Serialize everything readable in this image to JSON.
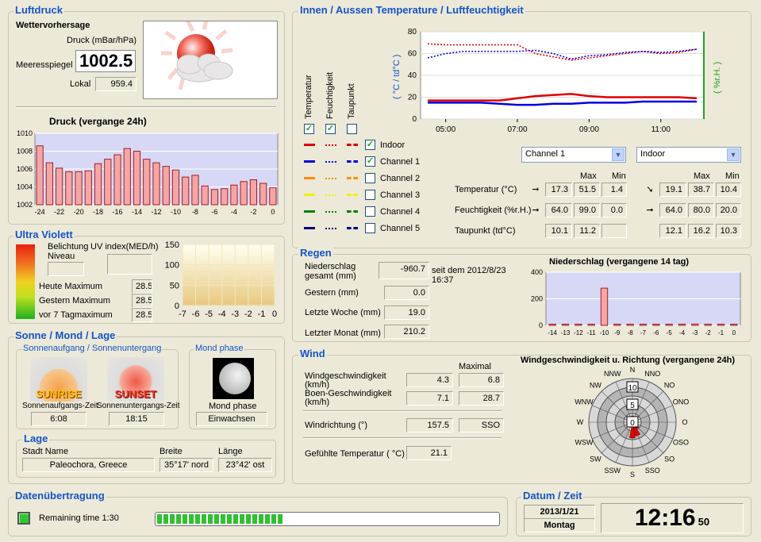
{
  "luftdruck": {
    "title": "Luftdruck",
    "forecast_label": "Wettervorhersage",
    "druck_label": "Druck (mBar/hPa)",
    "sea_label": "Meeresspiegel",
    "sea_value": "1002.5",
    "local_label": "Lokal",
    "local_value": "959.4",
    "chart_title": "Druck (vergange 24h)"
  },
  "temp_section": {
    "title": "Innen / Aussen Temperature / Luftfeuchtigkeit",
    "col_temp": "Temperatur",
    "col_hum": "Feuchtigkeit",
    "col_dew": "Taupunkt",
    "left_axis": "( °C / td°C )",
    "right_axis": "( %r.H. )",
    "channels": [
      {
        "name": "Indoor",
        "checked": true,
        "color": "#e00000"
      },
      {
        "name": "Channel 1",
        "checked": true,
        "color": "#0000e0"
      },
      {
        "name": "Channel 2",
        "checked": false,
        "color": "#ff8c00"
      },
      {
        "name": "Channel 3",
        "checked": false,
        "color": "#f0f000"
      },
      {
        "name": "Channel 4",
        "checked": false,
        "color": "#008000"
      },
      {
        "name": "Channel 5",
        "checked": false,
        "color": "#000080"
      }
    ],
    "select_left": "Channel 1",
    "select_right": "Indoor",
    "max_label": "Max",
    "min_label": "Min",
    "rows": [
      {
        "label": "Temperatur (°C)",
        "l_val": "17.3",
        "l_max": "51.5",
        "l_min": "1.4",
        "r_val": "19.1",
        "r_max": "38.7",
        "r_min": "10.4"
      },
      {
        "label": "Feuchtigkeit (%r.H.)",
        "l_val": "64.0",
        "l_max": "99.0",
        "l_min": "0.0",
        "r_val": "64.0",
        "r_max": "80.0",
        "r_min": "20.0"
      },
      {
        "label": "Taupunkt (td°C)",
        "l_val": "10.1",
        "l_max": "11.2",
        "l_min": "",
        "r_val": "12.1",
        "r_max": "16.2",
        "r_min": "10.3"
      }
    ]
  },
  "uv": {
    "title": "Ultra Violett",
    "belichtung": "Belichtung",
    "niveau": "Niveau",
    "uv_index": "UV index(MED/h)",
    "today_label": "Heute Maximum",
    "today": "28.5",
    "yesterday_label": "Gestern Maximum",
    "yesterday": "28.5",
    "week_label": "vor 7 Tagmaximum",
    "week": "28.5"
  },
  "sun": {
    "title": "Sonne / Mond / Lage",
    "sub": "Sonnenaufgang / Sonnenuntergang",
    "sunrise_img": "SUNRISE",
    "sunset_img": "SUNSET",
    "sunrise_label": "Sonnenaufgangs-Zeit",
    "sunset_label": "Sonnenuntergangs-Zeit",
    "sunrise": "6:08",
    "sunset": "18:15",
    "moon_title": "Mond phase",
    "moon_label": "Mond phase",
    "moon_value": "Einwachsen"
  },
  "lage": {
    "title": "Lage",
    "city_label": "Stadt Name",
    "city": "Paleochora, Greece",
    "lat_label": "Breite",
    "lat": "35°17' nord",
    "lon_label": "Länge",
    "lon": "23°42' ost"
  },
  "regen": {
    "title": "Regen",
    "total_label": "Niederschlag gesamt (mm)",
    "total": "-960.7",
    "since": "seit dem 2012/8/23 16:37",
    "yesterday_label": "Gestern (mm)",
    "yesterday": "0.0",
    "week_label": "Letzte Woche (mm)",
    "week": "19.0",
    "month_label": "Letzter Monat (mm)",
    "month": "210.2",
    "chart_title": "Niederschlag (vergangene 14 tag)"
  },
  "wind": {
    "title": "Wind",
    "max_label": "Maximal",
    "speed_label": "Windgeschwindigkeit (km/h)",
    "speed": "4.3",
    "speed_max": "6.8",
    "gust_label": "Boen-Geschwindigkeit (km/h)",
    "gust": "7.1",
    "gust_max": "28.7",
    "dir_label": "Windrichtung (°)",
    "dir": "157.5",
    "dir_name": "SSO",
    "feel_label": "Gefühlte Temperatur ( °C)",
    "feel": "21.1",
    "rose_title": "Windgeschwindigkeit u. Richtung (vergangene 24h)",
    "compass": [
      "N",
      "NNO",
      "NO",
      "ONO",
      "O",
      "OSO",
      "SO",
      "SSO",
      "S",
      "SSW",
      "SW",
      "WSW",
      "W",
      "WNW",
      "NW",
      "NNW"
    ],
    "ring_labels": [
      "10",
      "5",
      "0"
    ]
  },
  "transfer": {
    "title": "Datenübertragung",
    "remaining": "Remaining time 1:30",
    "progress": 0.37
  },
  "datetime": {
    "title": "Datum / Zeit",
    "date": "2013/1/21",
    "day": "Montag",
    "time": "12:16",
    "seconds": "50"
  },
  "chart_data": [
    {
      "type": "bar",
      "title": "Druck (vergange 24h)",
      "categories": [
        "-24",
        "-23",
        "-22",
        "-21",
        "-20",
        "-19",
        "-18",
        "-17",
        "-16",
        "-15",
        "-14",
        "-13",
        "-12",
        "-11",
        "-10",
        "-9",
        "-8",
        "-7",
        "-6",
        "-5",
        "-4",
        "-3",
        "-2",
        "-1",
        "0"
      ],
      "x_ticks": [
        "-24",
        "-22",
        "-20",
        "-18",
        "-16",
        "-14",
        "-12",
        "-10",
        "-8",
        "-6",
        "-4",
        "-2",
        "0"
      ],
      "values": [
        1008.6,
        1006.7,
        1006.1,
        1005.7,
        1005.7,
        1005.8,
        1006.6,
        1007.1,
        1007.6,
        1008.3,
        1008.0,
        1007.1,
        1006.7,
        1006.3,
        1005.9,
        1005.1,
        1005.3,
        1004.1,
        1003.7,
        1003.8,
        1004.2,
        1004.6,
        1004.8,
        1004.4,
        1003.9
      ],
      "ylim": [
        1002,
        1010
      ],
      "y_ticks": [
        "1010",
        "1008",
        "1006",
        "1004",
        "1002"
      ]
    },
    {
      "type": "line",
      "title": "Innen / Aussen Temperature / Luftfeuchtigkeit",
      "x_ticks": [
        "05:00",
        "07:00",
        "09:00",
        "11:00"
      ],
      "x": [
        4.5,
        5,
        5.5,
        6,
        6.5,
        7,
        7.5,
        8,
        8.5,
        9,
        9.5,
        10,
        10.5,
        11,
        11.5,
        12
      ],
      "ylim": [
        0,
        80
      ],
      "y_ticks": [
        "80",
        "60",
        "40",
        "20",
        "0"
      ],
      "series": [
        {
          "name": "Indoor",
          "color": "#e00000",
          "dash": false,
          "values": [
            17,
            17,
            17,
            17,
            17,
            19,
            21,
            22,
            23,
            21,
            20,
            20,
            20,
            20,
            20,
            19
          ]
        },
        {
          "name": "Channel 1",
          "color": "#0000e0",
          "dash": false,
          "values": [
            15,
            15,
            15,
            15,
            14,
            13,
            13,
            14,
            14,
            15,
            15,
            15,
            16,
            16,
            16,
            16
          ]
        },
        {
          "name": "Indoor",
          "color": "#e00000",
          "dash": true,
          "values": [
            69,
            68,
            68,
            68,
            68,
            68,
            60,
            57,
            54,
            56,
            58,
            60,
            62,
            60,
            61,
            64
          ]
        },
        {
          "name": "Channel 1",
          "color": "#0000e0",
          "dash": true,
          "values": [
            56,
            60,
            62,
            62,
            62,
            62,
            63,
            60,
            55,
            58,
            59,
            61,
            62,
            61,
            62,
            64
          ]
        }
      ]
    },
    {
      "type": "area",
      "title": "",
      "x_ticks": [
        "-7",
        "-6",
        "-5",
        "-4",
        "-3",
        "-2",
        "-1",
        "0"
      ],
      "values": [
        0,
        0,
        0,
        0,
        0,
        0,
        0,
        0
      ],
      "ylim": [
        0,
        150
      ],
      "y_ticks": [
        "150",
        "100",
        "50",
        "0"
      ]
    },
    {
      "type": "bar",
      "title": "Niederschlag (vergangene 14 tag)",
      "categories": [
        "-14",
        "-13",
        "-12",
        "-11",
        "-10",
        "-9",
        "-8",
        "-7",
        "-6",
        "-5",
        "-4",
        "-3",
        "-2",
        "-1",
        "0"
      ],
      "values": [
        0,
        0,
        0,
        0,
        280,
        0,
        0,
        0,
        0,
        0,
        0,
        10,
        0,
        0,
        0
      ],
      "ylim": [
        0,
        400
      ],
      "y_ticks": [
        "400",
        "200",
        "0"
      ]
    }
  ]
}
